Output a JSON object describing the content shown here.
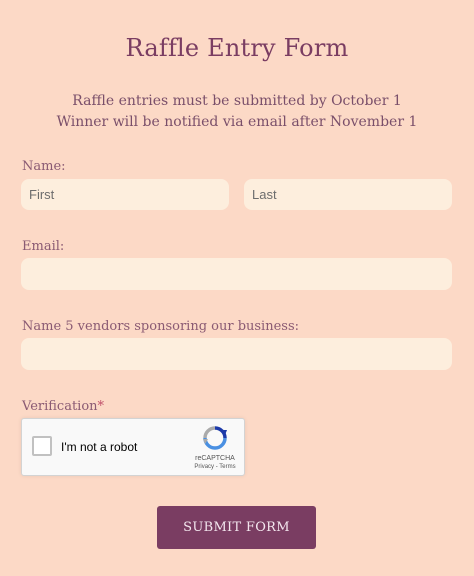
{
  "form": {
    "title": "Raffle Entry Form",
    "subtitle_line1": "Raffle entries must be submitted by October 1",
    "subtitle_line2": "Winner will be notified via email after November 1"
  },
  "name": {
    "label": "Name:",
    "first_placeholder": "First",
    "last_placeholder": "Last",
    "first_value": "",
    "last_value": ""
  },
  "email": {
    "label": "Email:",
    "value": ""
  },
  "vendors": {
    "label": "Name 5 vendors sponsoring our business:",
    "value": ""
  },
  "verification": {
    "label": "Verification",
    "required_mark": "*"
  },
  "captcha": {
    "text": "I'm not a robot",
    "brand": "reCAPTCHA",
    "links": "Privacy - Terms",
    "icon": "recaptcha-logo-icon"
  },
  "submit": {
    "label": "SUBMIT FORM"
  },
  "colors": {
    "background": "#fcd9c6",
    "field": "#fdeedd",
    "accent": "#7a3d62",
    "label": "#8a5a73"
  }
}
